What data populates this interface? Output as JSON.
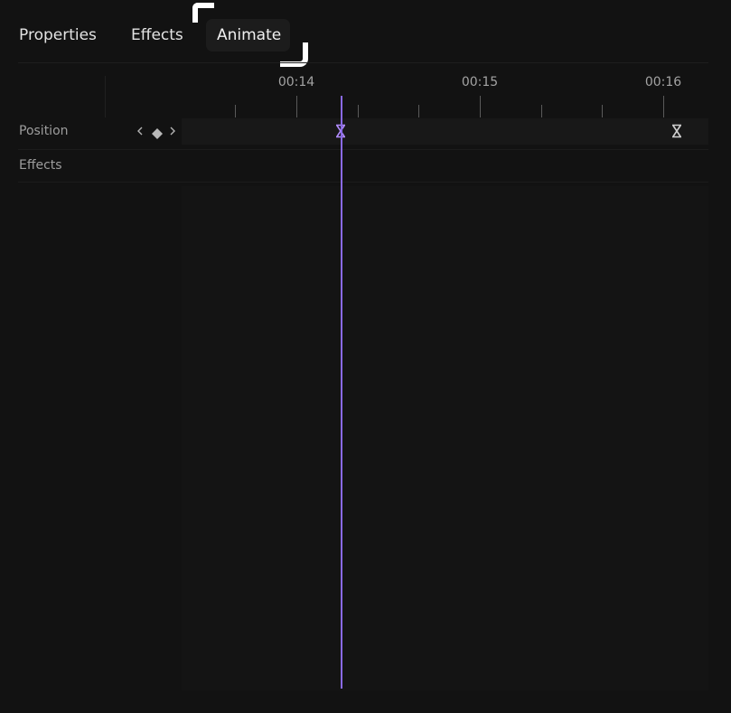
{
  "tabs": [
    {
      "label": "Properties",
      "active": false
    },
    {
      "label": "Effects",
      "active": false
    },
    {
      "label": "Animate",
      "active": true
    }
  ],
  "ruler": {
    "labels": [
      "00:14",
      "00:15",
      "00:16"
    ]
  },
  "rows": {
    "position_label": "Position",
    "effects_label": "Effects"
  },
  "icons": {
    "prev_keyframe": "chevron-left-icon",
    "add_keyframe": "diamond-icon",
    "next_keyframe": "chevron-right-icon",
    "keyframe": "hourglass-keyframe-icon"
  },
  "colors": {
    "background": "#121212",
    "playhead": "#8a6ae6",
    "keyframe_selected": "#b28cff",
    "keyframe_default": "#cfcfcf",
    "text": "#e3e3e3",
    "muted_text": "#9d9d9d"
  }
}
